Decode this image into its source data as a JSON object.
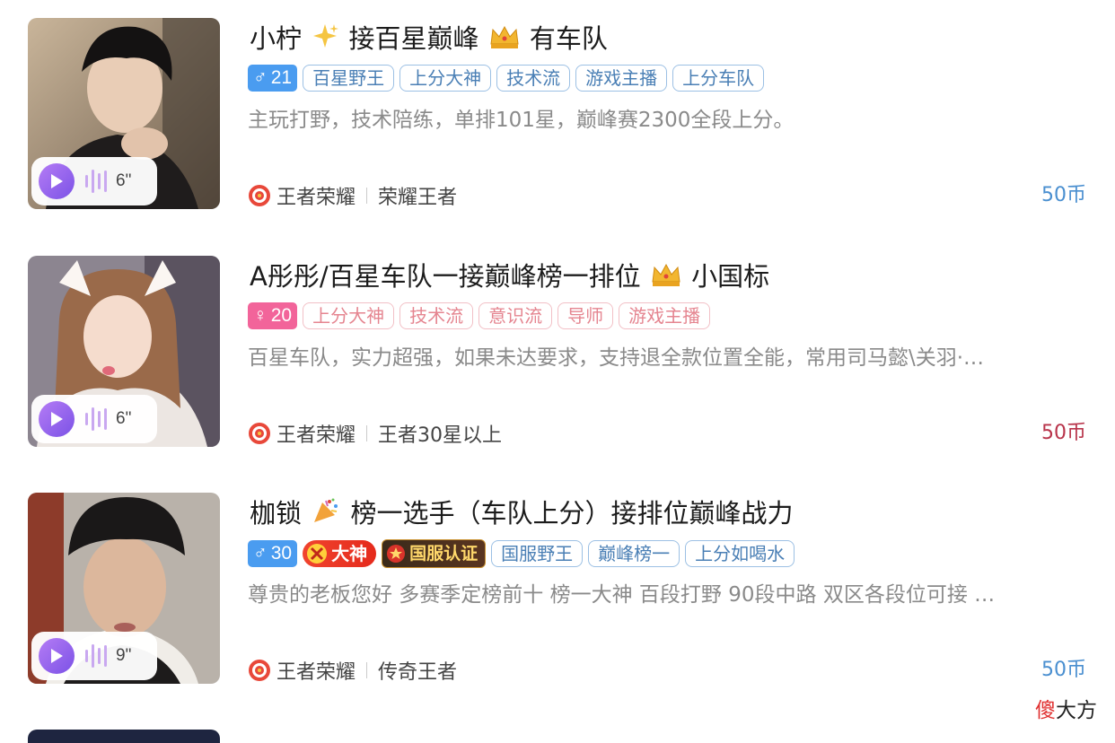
{
  "listings": [
    {
      "title_parts": [
        "小柠",
        "接百星巅峰",
        "有车队"
      ],
      "gender": "male",
      "age": "21",
      "tags": [
        "百星野王",
        "上分大神",
        "技术流",
        "游戏主播",
        "上分车队"
      ],
      "description": "主玩打野，技术陪练，单排101星，巅峰赛2300全段上分。",
      "game": "王者荣耀",
      "rank": "荣耀王者",
      "price": "50币",
      "voice_duration": "6\""
    },
    {
      "title_parts": [
        "A彤彤/百星车队一接巅峰榜一排位",
        "小国标"
      ],
      "gender": "female",
      "age": "20",
      "tags": [
        "上分大神",
        "技术流",
        "意识流",
        "导师",
        "游戏主播"
      ],
      "description": "百星车队，实力超强，如果未达要求，支持退全款位置全能，常用司马懿\\关羽·…",
      "game": "王者荣耀",
      "rank": "王者30星以上",
      "price": "50币",
      "voice_duration": "6\""
    },
    {
      "title_parts": [
        "枷锁",
        "榜一选手（车队上分）接排位巅峰战力"
      ],
      "gender": "male",
      "age": "30",
      "badges": [
        "大神",
        "国服认证"
      ],
      "tags": [
        "国服野王",
        "巅峰榜一",
        "上分如喝水"
      ],
      "description": "尊贵的老板您好 多赛季定榜前十 榜一大神 百段打野 90段中路  双区各段位可接 …",
      "game": "王者荣耀",
      "rank": "传奇王者",
      "price": "50币",
      "voice_duration": "9\""
    }
  ],
  "watermark": {
    "first": "傻",
    "rest": "大方"
  },
  "colors": {
    "accent_blue": "#4a8fd0",
    "price_red": "#b8334a",
    "male": "#4a9cf0",
    "female": "#f2649a"
  }
}
